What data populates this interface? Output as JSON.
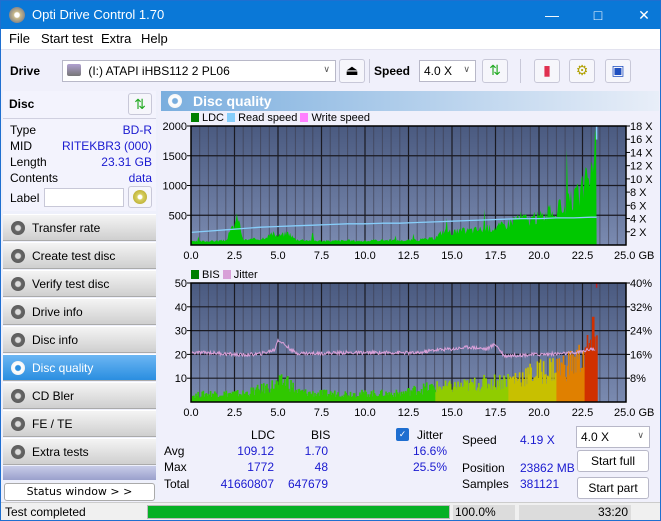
{
  "window": {
    "title": "Opti Drive Control 1.70"
  },
  "menu": [
    "File",
    "Start test",
    "Extra",
    "Help"
  ],
  "toolbar": {
    "drive_label": "Drive",
    "drive_value": "(I:)  ATAPI iHBS112   2 PL06",
    "speed_label": "Speed",
    "speed_value": "4.0 X"
  },
  "disc": {
    "header": "Disc",
    "rows": [
      {
        "key": "Type",
        "value": "BD-R"
      },
      {
        "key": "MID",
        "value": "RITEKBR3 (000)"
      },
      {
        "key": "Length",
        "value": "23.31 GB"
      },
      {
        "key": "Contents",
        "value": "data"
      }
    ],
    "label_key": "Label",
    "label_value": ""
  },
  "nav": [
    {
      "label": "Transfer rate",
      "active": false
    },
    {
      "label": "Create test disc",
      "active": false
    },
    {
      "label": "Verify test disc",
      "active": false
    },
    {
      "label": "Drive info",
      "active": false
    },
    {
      "label": "Disc info",
      "active": false
    },
    {
      "label": "Disc quality",
      "active": true
    },
    {
      "label": "CD Bler",
      "active": false
    },
    {
      "label": "FE / TE",
      "active": false
    },
    {
      "label": "Extra tests",
      "active": false
    }
  ],
  "status_window_btn": "Status window > >",
  "panel": {
    "title": "Disc quality"
  },
  "chart_data": [
    {
      "type": "area",
      "title": "LDC / Read speed",
      "legend": [
        {
          "name": "LDC",
          "color": "#008000"
        },
        {
          "name": "Read speed",
          "color": "#87cefa"
        },
        {
          "name": "Write speed",
          "color": "#ff80ff"
        }
      ],
      "xlabel": "GB",
      "xlim": [
        0,
        25
      ],
      "x_ticks": [
        "0.0",
        "2.5",
        "5.0",
        "7.5",
        "10.0",
        "12.5",
        "15.0",
        "17.5",
        "20.0",
        "22.5",
        "25.0 GB"
      ],
      "ylim": [
        0,
        2000
      ],
      "y_ticks": [
        "2000",
        "1500",
        "1000",
        "500"
      ],
      "y2lim": [
        0,
        18
      ],
      "y2_ticks": [
        "18 X",
        "16 X",
        "14 X",
        "12 X",
        "10 X",
        "8 X",
        "6 X",
        "4 X",
        "2 X"
      ],
      "series": [
        {
          "name": "LDC",
          "x": [
            0,
            1,
            2,
            2.7,
            3,
            4,
            4.7,
            5,
            5.6,
            6,
            7,
            8,
            9,
            10,
            11,
            12,
            13,
            14,
            14.5,
            15,
            16,
            17,
            18,
            18.8,
            19.5,
            20,
            20.5,
            21,
            21.5,
            22,
            22.5,
            23,
            23.2,
            23.31
          ],
          "y": [
            60,
            70,
            80,
            500,
            90,
            110,
            200,
            160,
            220,
            100,
            80,
            70,
            80,
            70,
            90,
            80,
            90,
            120,
            250,
            230,
            260,
            290,
            350,
            500,
            450,
            500,
            560,
            620,
            700,
            800,
            1000,
            1300,
            1600,
            1772
          ]
        },
        {
          "name": "Read speed",
          "x": [
            0,
            1,
            2,
            3,
            4,
            5,
            6,
            7,
            8,
            9,
            10,
            11,
            12,
            13,
            14,
            15,
            16,
            17,
            18,
            19,
            20,
            21,
            22,
            23,
            23.31
          ],
          "y": [
            1.9,
            2.1,
            2.3,
            2.5,
            2.7,
            2.8,
            2.9,
            3.0,
            3.1,
            3.2,
            3.2,
            3.3,
            3.3,
            3.4,
            3.5,
            3.6,
            3.7,
            3.8,
            3.9,
            4.0,
            4.0,
            4.1,
            4.1,
            4.2,
            4.2
          ]
        }
      ]
    },
    {
      "type": "bar",
      "title": "BIS / Jitter",
      "legend": [
        {
          "name": "BIS",
          "color": "#008000"
        },
        {
          "name": "Jitter",
          "color": "#d8a0d8"
        }
      ],
      "xlabel": "GB",
      "xlim": [
        0,
        25
      ],
      "x_ticks": [
        "0.0",
        "2.5",
        "5.0",
        "7.5",
        "10.0",
        "12.5",
        "15.0",
        "17.5",
        "20.0",
        "22.5",
        "25.0 GB"
      ],
      "ylim": [
        0,
        50
      ],
      "y_ticks": [
        "50",
        "40",
        "30",
        "20",
        "10"
      ],
      "y2lim": [
        0,
        40
      ],
      "y2_ticks": [
        "40%",
        "32%",
        "24%",
        "16%",
        "8%"
      ],
      "series": [
        {
          "name": "BIS",
          "x": [
            0,
            1,
            2,
            3,
            4,
            4.8,
            5.5,
            6,
            7,
            8,
            9,
            10,
            11,
            12,
            13,
            14,
            15,
            16,
            17,
            18,
            19,
            20,
            21,
            22,
            22.8,
            23.2,
            23.31
          ],
          "y": [
            3,
            4,
            4,
            4,
            6,
            8,
            10,
            5,
            4,
            4,
            4,
            4,
            4,
            4,
            6,
            7,
            7,
            8,
            9,
            10,
            12,
            14,
            16,
            18,
            24,
            30,
            48
          ]
        },
        {
          "name": "Jitter",
          "x": [
            0,
            1,
            2,
            3,
            4,
            4.8,
            5,
            6,
            7,
            8,
            9,
            10,
            11,
            12,
            13,
            14,
            15,
            16,
            17,
            17.5,
            18,
            19,
            20,
            21,
            22,
            22.5,
            23,
            23.2
          ],
          "y": [
            16.5,
            16.6,
            16.2,
            15.8,
            16.2,
            17.5,
            21,
            16.5,
            16.3,
            16.5,
            16.6,
            16.5,
            16.6,
            16.6,
            16.4,
            17.5,
            17.8,
            18.5,
            17.8,
            19.5,
            15.5,
            15.8,
            16.0,
            16.2,
            16.4,
            17.0,
            18.0,
            17.5
          ]
        }
      ]
    }
  ],
  "stats": {
    "col_ldc": "LDC",
    "col_bis": "BIS",
    "rows": [
      {
        "label": "Avg",
        "ldc": "109.12",
        "bis": "1.70",
        "jitter": "16.6%"
      },
      {
        "label": "Max",
        "ldc": "1772",
        "bis": "48",
        "jitter": "25.5%"
      },
      {
        "label": "Total",
        "ldc": "41660807",
        "bis": "647679"
      }
    ],
    "jitter_label": "Jitter",
    "jitter_checked": true,
    "speed_label": "Speed",
    "speed_value": "4.19 X",
    "position_label": "Position",
    "position_value": "23862 MB",
    "samples_label": "Samples",
    "samples_value": "381121",
    "speed_select": "4.0 X",
    "start_full": "Start full",
    "start_part": "Start part"
  },
  "statusbar": {
    "text": "Test completed",
    "progress_percent": 100,
    "progress_text": "100.0%",
    "time": "33:20"
  }
}
